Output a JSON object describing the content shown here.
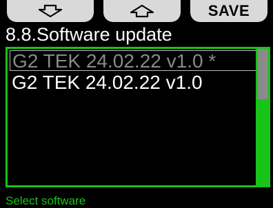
{
  "softkeys": {
    "left": {
      "icon": "arrow-down-icon"
    },
    "center": {
      "icon": "arrow-up-icon"
    },
    "right": {
      "label": "SAVE"
    }
  },
  "header": {
    "title": "8.8.Software update"
  },
  "list": {
    "items": [
      {
        "label": "G2 TEK 24.02.22 v1.0 *",
        "state": "highlighted"
      },
      {
        "label": "G2 TEK 24.02.22 v1.0",
        "state": "normal"
      }
    ],
    "scroll": {
      "thumb_fraction": 0.37,
      "position": 0
    }
  },
  "status": {
    "text": "Select software"
  },
  "colors": {
    "accent": "#18c418",
    "softkey_bg": "#d9d9d9",
    "highlight_text": "#8a8a8a",
    "background": "#000000"
  }
}
